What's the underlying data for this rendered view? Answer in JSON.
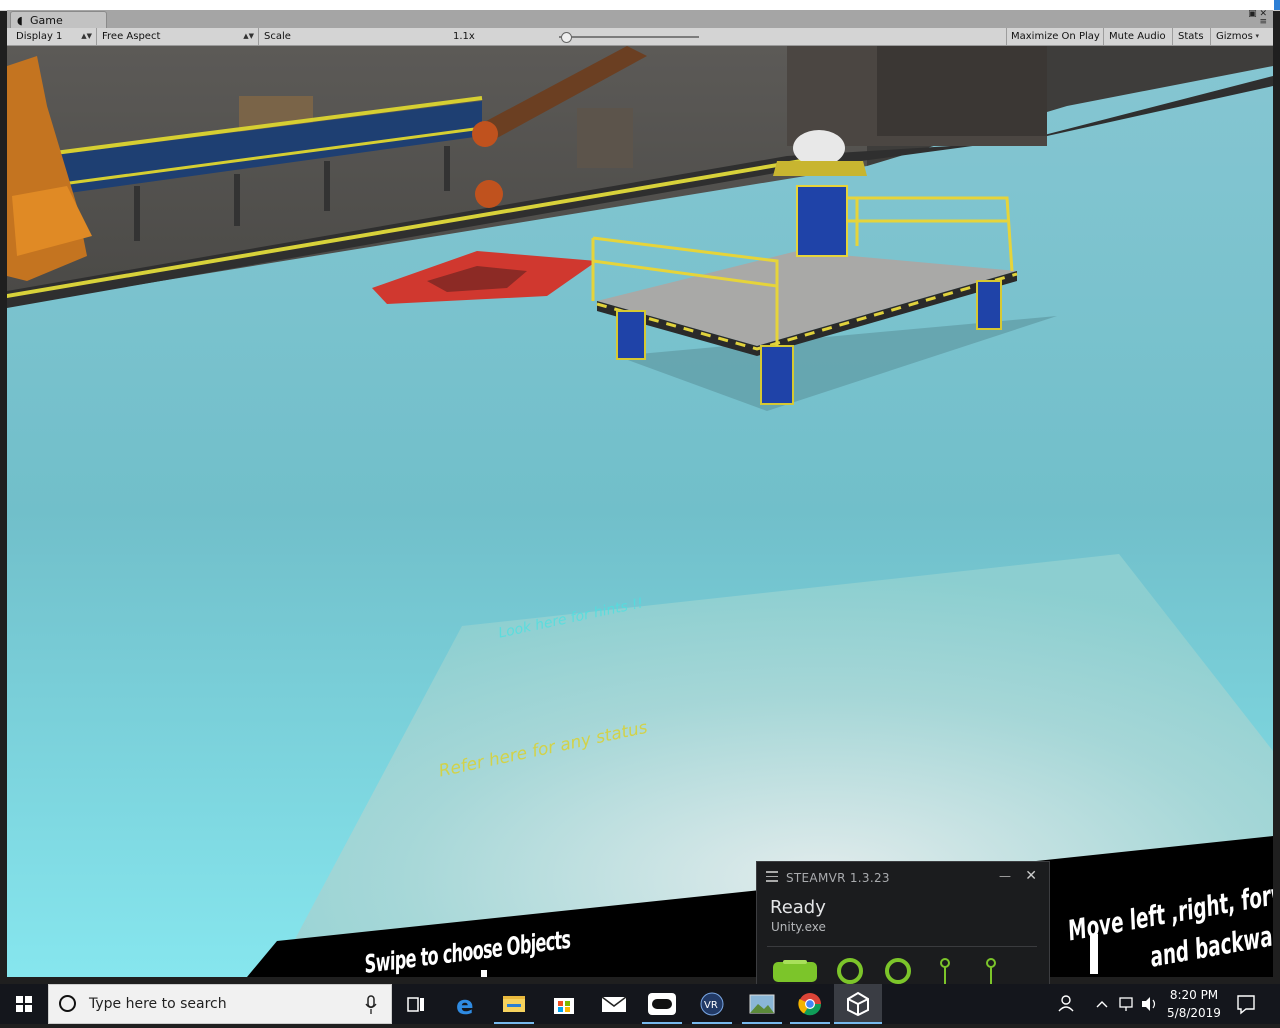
{
  "window": {
    "tab_label": "Game",
    "tab_icon": "unity-icon",
    "controls": "▣ ✕\n≡"
  },
  "toolbar": {
    "display": "Display 1",
    "aspect": "Free Aspect",
    "scale_label": "Scale",
    "scale_value": "1.1x",
    "scale_fraction": 0.05,
    "maximize_on_play": "Maximize On Play",
    "mute_audio": "Mute Audio",
    "stats": "Stats",
    "gizmos": "Gizmos"
  },
  "scene": {
    "hint_cyan": "Look here for hints !!",
    "hint_yellow": "Refer here for any status",
    "swipe_panel": "Swipe to choose Objects",
    "move_panel_line1": "Move left ,right, forw",
    "move_panel_line2": "and backward"
  },
  "steamvr": {
    "title": "STEAMVR 1.3.23",
    "status": "Ready",
    "app": "Unity.exe",
    "devices": [
      "headset-icon",
      "controller-icon",
      "controller-icon",
      "base-station-icon",
      "base-station-icon"
    ],
    "accent": "#7cc52a"
  },
  "taskbar": {
    "search_placeholder": "Type here to search",
    "apps": [
      "task-view-icon",
      "edge-icon",
      "file-explorer-icon",
      "store-icon",
      "mail-icon",
      "oculus-icon",
      "vr-icon",
      "photos-icon",
      "chrome-icon",
      "unity-icon"
    ],
    "time": "8:20 PM",
    "date": "5/8/2019"
  }
}
